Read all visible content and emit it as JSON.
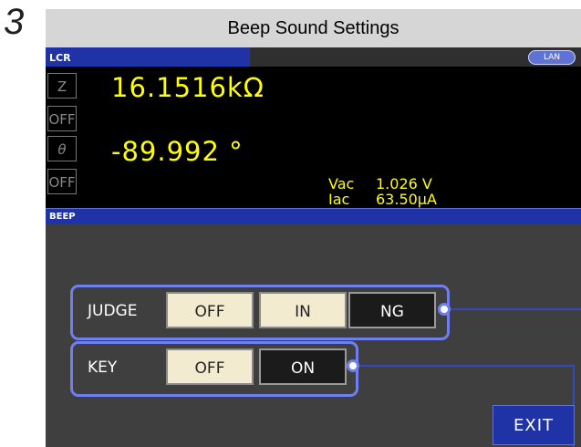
{
  "step_number": "3",
  "title": "Beep Sound Settings",
  "status_bar": {
    "mode": "LCR",
    "lan": "LAN"
  },
  "measurement": {
    "param1": "Z",
    "param1_off": "OFF",
    "value1": "16.1516kΩ",
    "param2": "θ",
    "param2_off": "OFF",
    "value2": "-89.992 °",
    "vac_label": "Vac",
    "vac_value": "1.026 V",
    "iac_label": "Iac",
    "iac_value": "63.50μA"
  },
  "beep": {
    "header": "BEEP",
    "judge": {
      "label": "JUDGE",
      "options": [
        "OFF",
        "IN",
        "NG"
      ],
      "selected": "NG"
    },
    "key": {
      "label": "KEY",
      "options": [
        "OFF",
        "ON"
      ],
      "selected": "ON"
    },
    "exit_label": "EXIT"
  },
  "colors": {
    "accent_blue": "#1f33a7",
    "measurement_yellow": "#ffff00",
    "highlight_frame": "#6f7ff0",
    "button_unselected": "#f3ebcf",
    "button_selected": "#1b1b1b"
  }
}
